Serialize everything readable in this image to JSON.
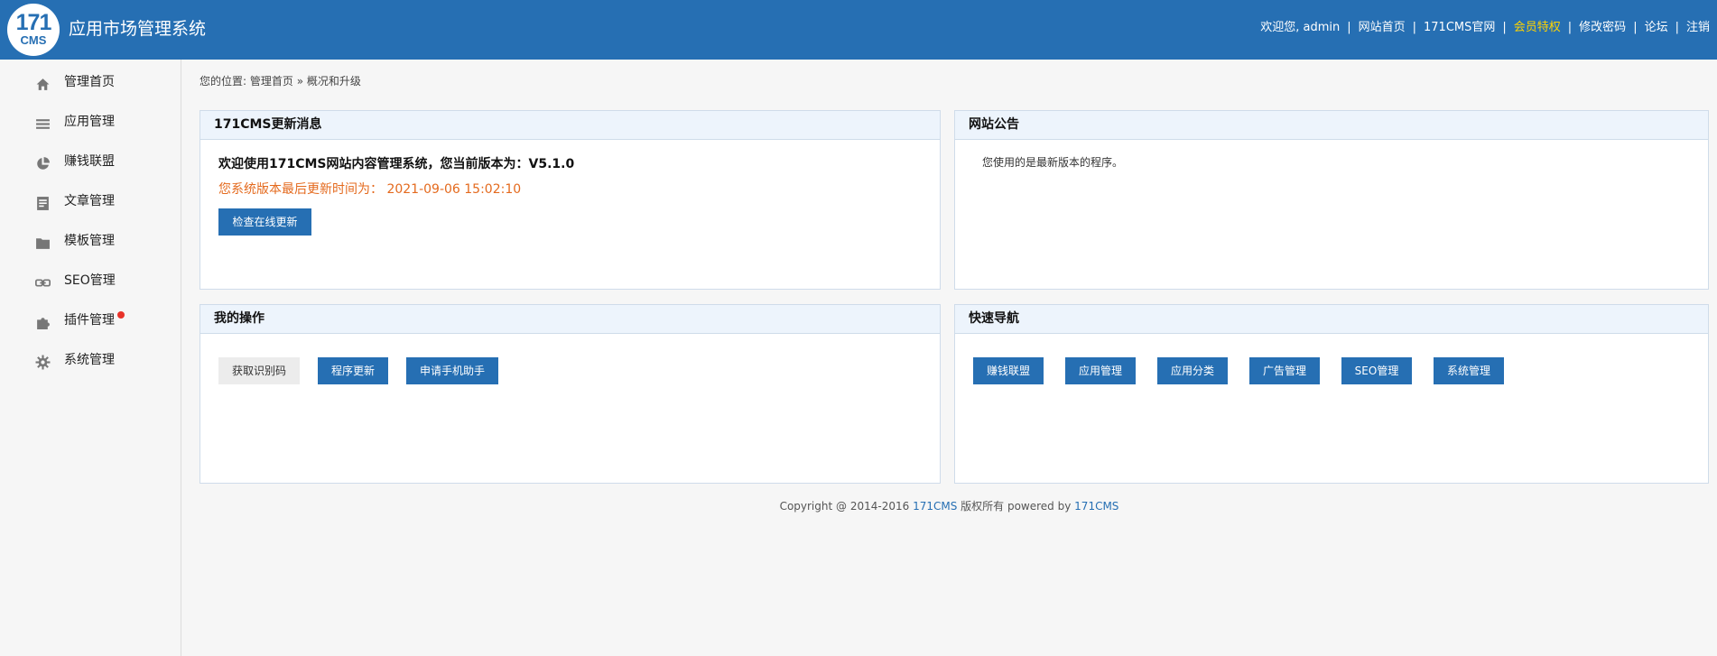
{
  "header": {
    "logo_number": "171",
    "logo_text": "CMS",
    "title": "应用市场管理系统",
    "welcome": "欢迎您, admin",
    "links": [
      "网站首页",
      "171CMS官网",
      "会员特权",
      "修改密码",
      "论坛",
      "注销"
    ],
    "vip_color": "#ffd400"
  },
  "sidebar": {
    "items": [
      {
        "label": "管理首页",
        "icon": "home-icon"
      },
      {
        "label": "应用管理",
        "icon": "menu-lines-icon"
      },
      {
        "label": "赚钱联盟",
        "icon": "pie-chart-icon"
      },
      {
        "label": "文章管理",
        "icon": "document-icon"
      },
      {
        "label": "模板管理",
        "icon": "folder-icon"
      },
      {
        "label": "SEO管理",
        "icon": "link-icon"
      },
      {
        "label": "插件管理",
        "icon": "puzzle-icon",
        "badge": true
      },
      {
        "label": "系统管理",
        "icon": "gear-icon"
      }
    ]
  },
  "breadcrumb": {
    "prefix": "您的位置:",
    "home": "管理首页",
    "separator": "»",
    "current": "概况和升级"
  },
  "panels": {
    "update": {
      "title": "171CMS更新消息",
      "welcome": "欢迎使用171CMS网站内容管理系统，您当前版本为：V5.1.0",
      "last_update": "您系统版本最后更新时间为： 2021-09-06 15:02:10",
      "check_button": "检查在线更新"
    },
    "notice": {
      "title": "网站公告",
      "text": "您使用的是最新版本的程序。"
    },
    "my_ops": {
      "title": "我的操作",
      "buttons": [
        "获取识别码",
        "程序更新",
        "申请手机助手"
      ]
    },
    "quick_nav": {
      "title": "快速导航",
      "buttons": [
        "赚钱联盟",
        "应用管理",
        "应用分类",
        "广告管理",
        "SEO管理",
        "系统管理"
      ]
    }
  },
  "footer": {
    "copyright": "Copyright @ 2014-2016",
    "brand": "171CMS",
    "rights": "版权所有 powered by",
    "brand2": "171CMS"
  },
  "colors": {
    "primary": "#266fb3",
    "header_bg": "#266fb3",
    "accent_orange": "#e46a1e",
    "badge_red": "#e8332a"
  }
}
